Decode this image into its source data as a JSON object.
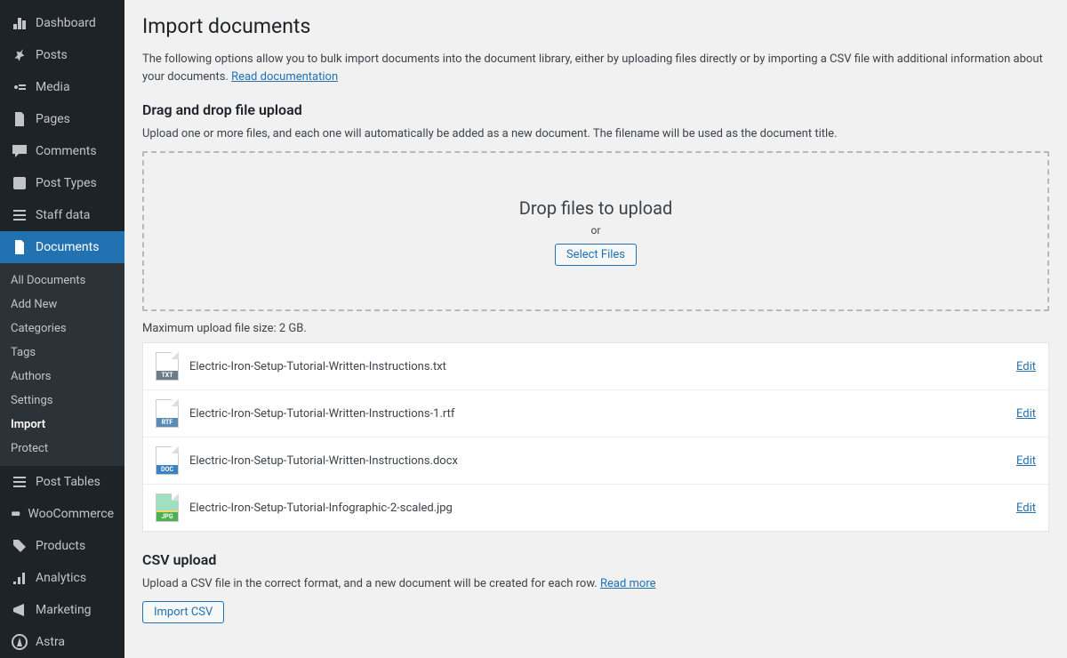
{
  "sidebar": {
    "items": [
      {
        "label": "Dashboard",
        "icon": "dashboard"
      },
      {
        "label": "Posts",
        "icon": "pin"
      },
      {
        "label": "Media",
        "icon": "media"
      },
      {
        "label": "Pages",
        "icon": "pages"
      },
      {
        "label": "Comments",
        "icon": "comment"
      },
      {
        "label": "Post Types",
        "icon": "posttypes"
      },
      {
        "label": "Staff data",
        "icon": "list"
      },
      {
        "label": "Documents",
        "icon": "document",
        "active": true
      },
      {
        "label": "Post Tables",
        "icon": "list"
      },
      {
        "label": "WooCommerce",
        "icon": "woo"
      },
      {
        "label": "Products",
        "icon": "products"
      },
      {
        "label": "Analytics",
        "icon": "analytics"
      },
      {
        "label": "Marketing",
        "icon": "marketing"
      },
      {
        "label": "Astra",
        "icon": "astra"
      }
    ],
    "submenu": [
      {
        "label": "All Documents"
      },
      {
        "label": "Add New"
      },
      {
        "label": "Categories"
      },
      {
        "label": "Tags"
      },
      {
        "label": "Authors"
      },
      {
        "label": "Settings"
      },
      {
        "label": "Import",
        "current": true
      },
      {
        "label": "Protect"
      }
    ]
  },
  "page": {
    "title": "Import documents",
    "intro_text": "The following options allow you to bulk import documents into the document library, either by uploading files directly or by importing a CSV file with additional information about your documents. ",
    "intro_link": "Read documentation",
    "drag_heading": "Drag and drop file upload",
    "drag_sub": "Upload one or more files, and each one will automatically be added as a new document. The filename will be used as the document title.",
    "drop_title": "Drop files to upload",
    "or": "or",
    "select_btn": "Select Files",
    "max_size": "Maximum upload file size: 2 GB.",
    "edit_label": "Edit",
    "csv_heading": "CSV upload",
    "csv_sub": "Upload a CSV file in the correct format, and a new document will be created for each row. ",
    "csv_more": "Read more",
    "import_btn": "Import CSV"
  },
  "files": [
    {
      "name": "Electric-Iron-Setup-Tutorial-Written-Instructions.txt",
      "ext": "TXT",
      "cls": "txt"
    },
    {
      "name": "Electric-Iron-Setup-Tutorial-Written-Instructions-1.rtf",
      "ext": "RTF",
      "cls": "rtf"
    },
    {
      "name": "Electric-Iron-Setup-Tutorial-Written-Instructions.docx",
      "ext": "DOC",
      "cls": "docx"
    },
    {
      "name": "Electric-Iron-Setup-Tutorial-Infographic-2-scaled.jpg",
      "ext": "JPG",
      "cls": "jpg"
    }
  ]
}
